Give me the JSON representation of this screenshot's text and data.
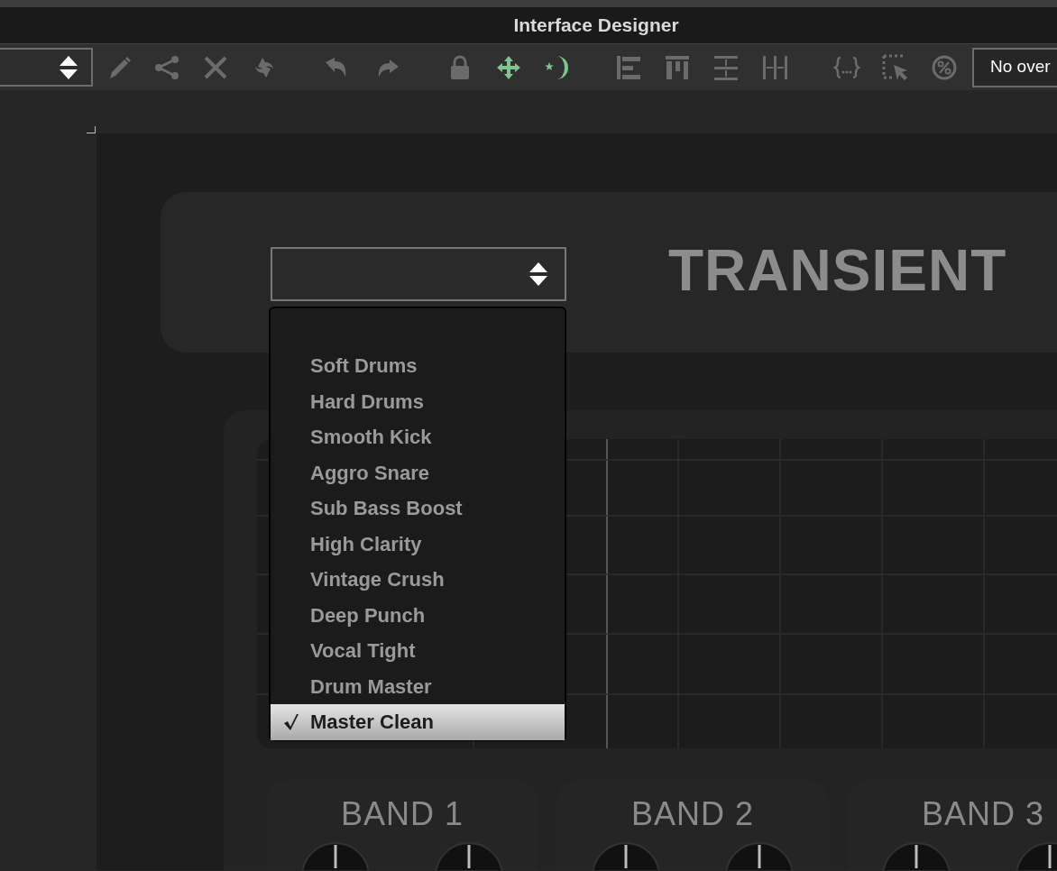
{
  "window": {
    "title": "Interface Designer"
  },
  "toolbar": {
    "tools": [
      {
        "kind": "pencil",
        "active": false
      },
      {
        "kind": "share",
        "active": false
      },
      {
        "kind": "cross",
        "active": false
      },
      {
        "kind": "swap",
        "active": false
      },
      {
        "kind": "undo",
        "active": false
      },
      {
        "kind": "redo",
        "active": false
      },
      {
        "kind": "lock",
        "active": false
      },
      {
        "kind": "move",
        "active": true
      },
      {
        "kind": "moon",
        "active": true
      },
      {
        "kind": "align-left",
        "active": false
      },
      {
        "kind": "align-top",
        "active": false
      },
      {
        "kind": "distribute-v",
        "active": false
      },
      {
        "kind": "distribute-h",
        "active": false
      },
      {
        "kind": "braces",
        "active": false
      },
      {
        "kind": "select",
        "active": false
      },
      {
        "kind": "percent",
        "active": false
      }
    ],
    "overlay_select": {
      "value": "No over"
    }
  },
  "canvas": {
    "plugin_title": "TRANSIENT",
    "preset_menu": {
      "items": [
        {
          "label": "Soft Drums",
          "selected": false
        },
        {
          "label": "Hard Drums",
          "selected": false
        },
        {
          "label": "Smooth Kick",
          "selected": false
        },
        {
          "label": "Aggro Snare",
          "selected": false
        },
        {
          "label": "Sub Bass Boost",
          "selected": false
        },
        {
          "label": "High Clarity",
          "selected": false
        },
        {
          "label": "Vintage Crush",
          "selected": false
        },
        {
          "label": "Deep Punch",
          "selected": false
        },
        {
          "label": "Vocal Tight",
          "selected": false
        },
        {
          "label": "Drum Master",
          "selected": false
        },
        {
          "label": "Master Clean",
          "selected": true
        }
      ]
    },
    "bands": [
      {
        "label": "BAND 1"
      },
      {
        "label": "BAND 2"
      },
      {
        "label": "BAND 3"
      }
    ]
  }
}
